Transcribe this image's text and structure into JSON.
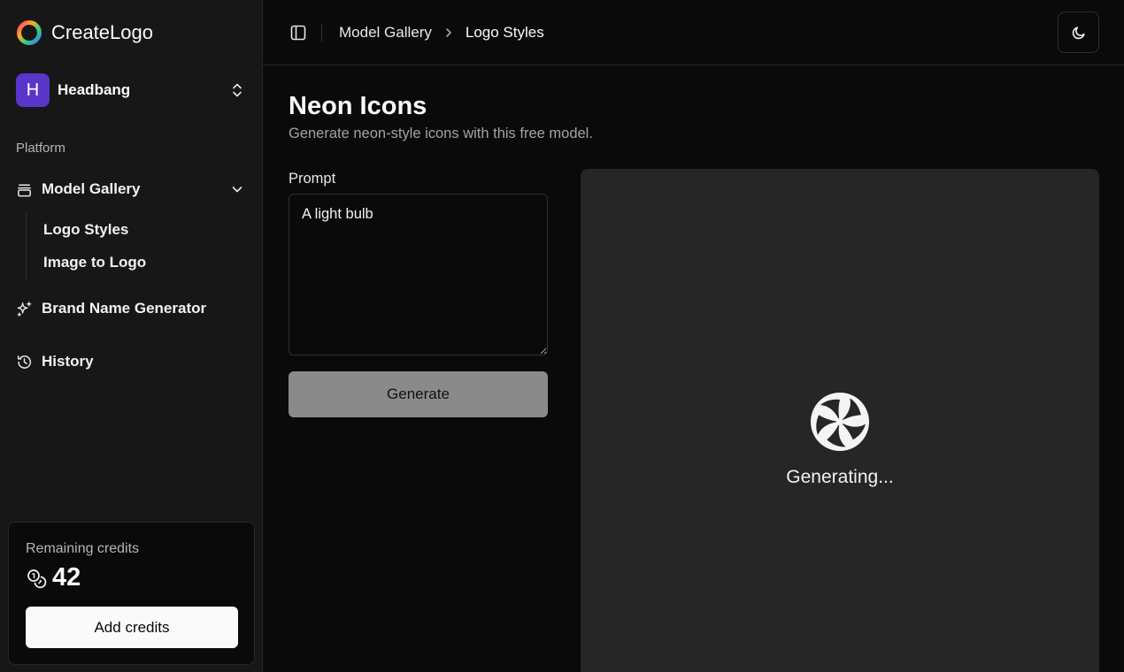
{
  "app": {
    "name": "CreateLogo"
  },
  "team": {
    "initial": "H",
    "name": "Headbang",
    "avatar_color": "#5b35c9"
  },
  "sidebar": {
    "section_label": "Platform",
    "items": [
      {
        "label": "Model Gallery",
        "icon": "gallery-icon",
        "expanded": true,
        "children": [
          {
            "label": "Logo Styles"
          },
          {
            "label": "Image to Logo"
          }
        ]
      },
      {
        "label": "Brand Name Generator",
        "icon": "sparkles-icon"
      },
      {
        "label": "History",
        "icon": "history-icon"
      }
    ]
  },
  "credits": {
    "label": "Remaining credits",
    "value": "42",
    "button_label": "Add credits"
  },
  "header": {
    "breadcrumb": [
      "Model Gallery",
      "Logo Styles"
    ],
    "theme_icon": "moon-icon"
  },
  "main": {
    "title": "Neon Icons",
    "subtitle": "Generate neon-style icons with this free model.",
    "prompt_label": "Prompt",
    "prompt_value": "A light bulb",
    "generate_label": "Generate",
    "status_text": "Generating..."
  },
  "colors": {
    "background": "#0a0a0a",
    "sidebar": "#171717",
    "preview_bg": "#262626",
    "button_disabled": "#8a8a8a"
  }
}
